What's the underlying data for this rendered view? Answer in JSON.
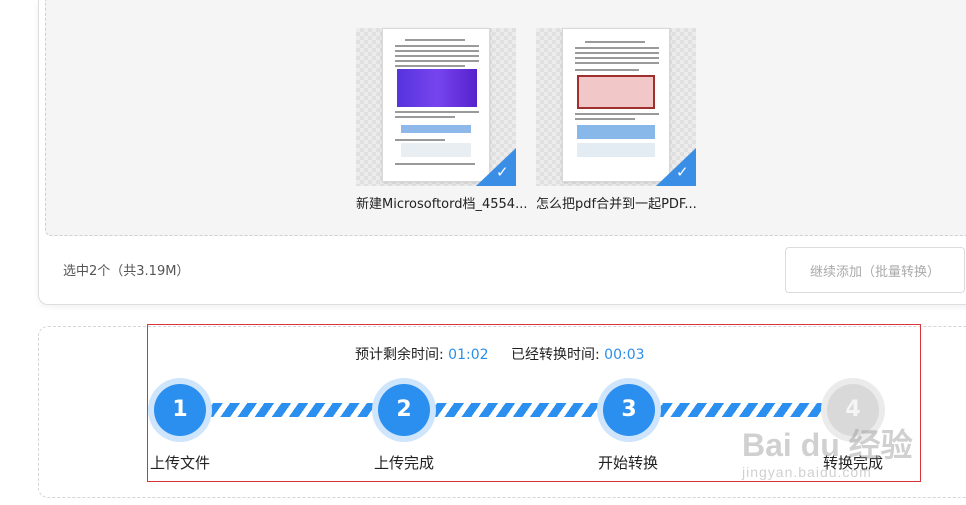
{
  "upload": {
    "files": [
      {
        "name": "新建Microsoftord档_4554...",
        "selected": true
      },
      {
        "name": "怎么把pdf合并到一起PDF...",
        "selected": true
      }
    ],
    "selection_info": "选中2个（共3.19M）",
    "continue_button": "继续添加（批量转换）"
  },
  "progress": {
    "remaining_label": "预计剩余时间:",
    "remaining_value": "01:02",
    "elapsed_label": "已经转换时间:",
    "elapsed_value": "00:03",
    "steps": [
      {
        "number": "1",
        "label": "上传文件",
        "active": true
      },
      {
        "number": "2",
        "label": "上传完成",
        "active": true
      },
      {
        "number": "3",
        "label": "开始转换",
        "active": true
      },
      {
        "number": "4",
        "label": "转换完成",
        "active": false
      }
    ]
  },
  "watermark": {
    "top": "Bai du 经验",
    "bottom": "jingyan.baidu.com"
  },
  "colors": {
    "accent": "#2b8ff0",
    "highlight": "#d9343a",
    "check": "#3a8ee6"
  }
}
